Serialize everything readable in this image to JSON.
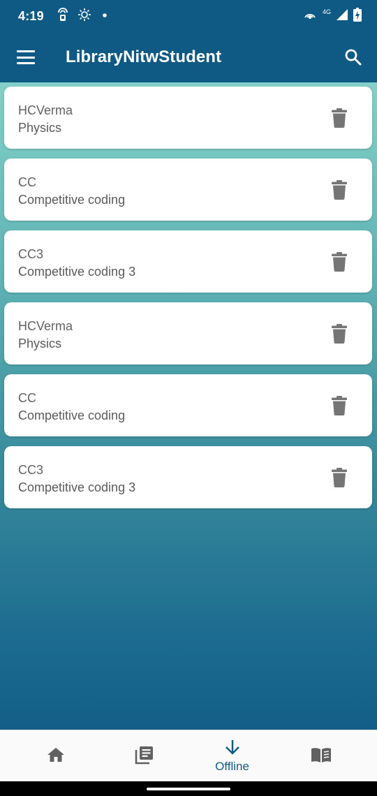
{
  "status_bar": {
    "time": "4:19",
    "network_label": "4G",
    "icons": [
      "hotspot-icon",
      "brightness-icon",
      "notification-dot-icon",
      "wifi-calling-icon",
      "signal-icon",
      "battery-charging-icon"
    ]
  },
  "app_bar": {
    "title": "LibraryNitwStudent",
    "menu_icon": "menu-icon",
    "search_icon": "search-icon"
  },
  "books": [
    {
      "title": "HCVerma",
      "subject": "Physics"
    },
    {
      "title": "CC",
      "subject": "Competitive coding"
    },
    {
      "title": "CC3",
      "subject": "Competitive coding 3"
    },
    {
      "title": "HCVerma",
      "subject": "Physics"
    },
    {
      "title": "CC",
      "subject": "Competitive coding"
    },
    {
      "title": "CC3",
      "subject": "Competitive coding 3"
    }
  ],
  "bottom_nav": {
    "items": [
      {
        "icon": "home-icon",
        "label": ""
      },
      {
        "icon": "library-books-icon",
        "label": ""
      },
      {
        "icon": "arrow-down-icon",
        "label": "Offline",
        "selected": true
      },
      {
        "icon": "book-icon",
        "label": ""
      }
    ]
  },
  "colors": {
    "primary": "#0f5a84",
    "gradient_top": "#82d0c8",
    "gradient_bottom": "#125e88",
    "card": "#ffffff",
    "icon_gray": "#757575"
  }
}
